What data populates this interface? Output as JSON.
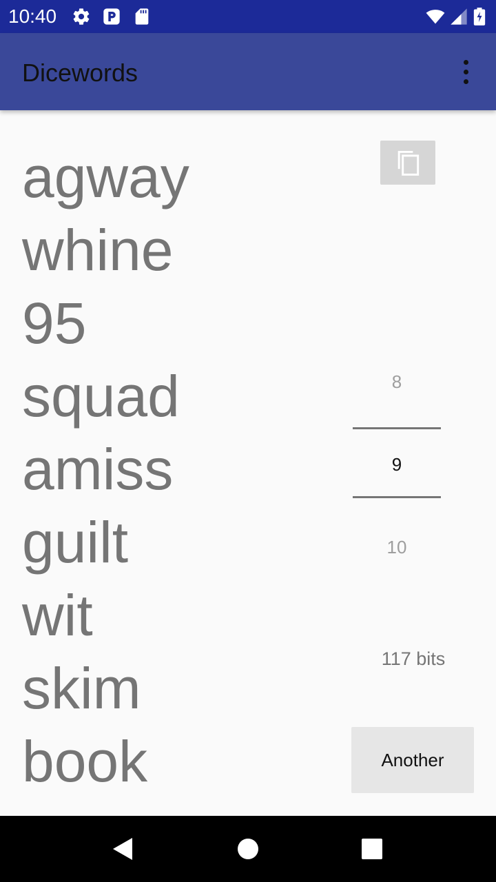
{
  "status_bar": {
    "time": "10:40",
    "left_icons": [
      "gear-icon",
      "p-icon",
      "sd-card-icon"
    ],
    "right_icons": [
      "wifi-icon",
      "signal-icon",
      "battery-icon"
    ]
  },
  "app_bar": {
    "title": "Dicewords",
    "menu_icon": "more-vert-icon"
  },
  "passphrase": {
    "words": [
      "agway",
      "whine",
      "95",
      "squad",
      "amiss",
      "guilt",
      "wit",
      "skim",
      "book"
    ]
  },
  "copy_button": {
    "icon": "copy-icon"
  },
  "word_count_picker": {
    "previous": "8",
    "current": "9",
    "next": "10"
  },
  "entropy": {
    "label": "117 bits"
  },
  "another_button": {
    "label": "Another"
  },
  "nav_bar": {
    "buttons": [
      "back-icon",
      "home-icon",
      "recents-icon"
    ]
  },
  "colors": {
    "status_bar": "#1c2a98",
    "app_bar": "#3a4899",
    "background": "#fafafa",
    "word_text": "#757575",
    "button_bg": "#e6e6e6"
  }
}
